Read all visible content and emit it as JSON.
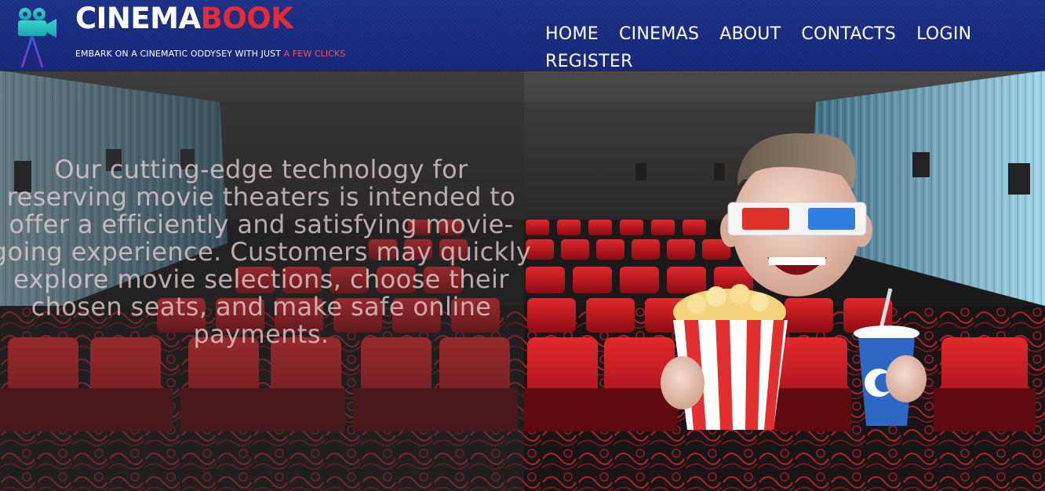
{
  "header": {
    "brand_part1": "CINEMA",
    "brand_part2": "BOOK",
    "tagline_part1": "EMBARK ON A CINEMATIC ODDYSEY WITH JUST ",
    "tagline_part2": "A FEW CLICKS",
    "logo_icon": "movie-camera-icon"
  },
  "nav": {
    "items": [
      "HOME",
      "CINEMAS",
      "ABOUT",
      "CONTACTS",
      "LOGIN",
      "REGISTER"
    ]
  },
  "hero": {
    "text": "Our cutting-edge technology for reserving movie theaters is intended to offer a efficiently and satisfying movie-going experience. Customers may quickly explore movie selections, choose their chosen seats, and make safe online payments.",
    "mascot_icon": "popcorn-3d-glasses-mascot"
  },
  "colors": {
    "header_bg": "#1b2f86",
    "brand_accent": "#e52b36",
    "seat_red": "#c0141b",
    "wall_teal": "#5a8aa0"
  }
}
